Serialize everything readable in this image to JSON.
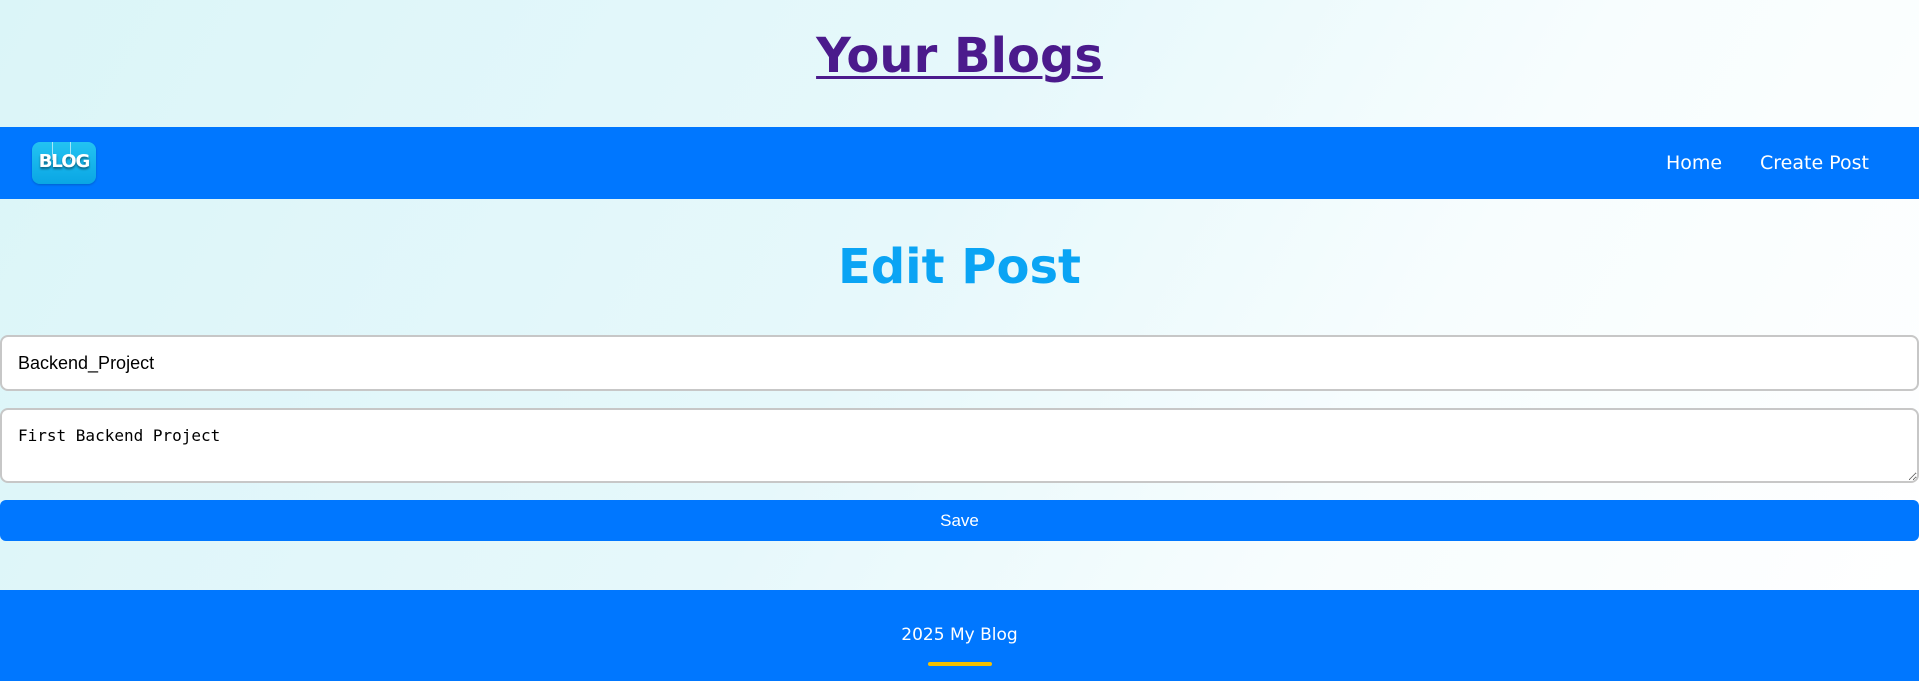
{
  "header": {
    "site_title": "Your Blogs"
  },
  "nav": {
    "logo_text": "BLOG",
    "links": [
      {
        "label": "Home"
      },
      {
        "label": "Create Post"
      }
    ]
  },
  "main": {
    "heading": "Edit Post",
    "form": {
      "title_value": "Backend_Project",
      "content_value": "First Backend Project",
      "save_label": "Save"
    }
  },
  "footer": {
    "text": "2025 My Blog"
  },
  "colors": {
    "title": "#4b1a8c",
    "nav_background": "#0077ff",
    "heading": "#0aa4f4",
    "button": "#0077ff",
    "footer_accent": "#f5c000"
  }
}
